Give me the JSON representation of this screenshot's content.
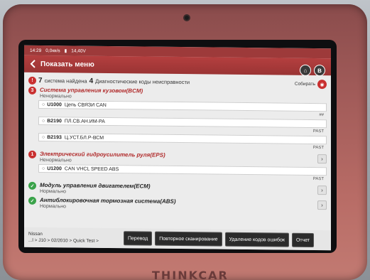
{
  "device": {
    "brand": "THINKCAR"
  },
  "status_bar": {
    "time": "14:29",
    "net_speed": "0,0кв/s",
    "voltage": "14,40V"
  },
  "header": {
    "title": "Показать меню"
  },
  "summary": {
    "systems_count": "7",
    "text_found": "система найдена",
    "dtc_count": "4",
    "text_dtc": "Диагностические коды неисправности"
  },
  "collect_label": "Собирать",
  "systems": [
    {
      "name": "Система управления кузовом(BCM)",
      "state": "Ненормально",
      "badge": "3",
      "status": "fault",
      "dtcs": [
        {
          "code": "U1000",
          "desc": "Цепь СВЯЗИ CAN",
          "status": "##"
        },
        {
          "code": "B2190",
          "desc": "ПЛ.СВ.АН.ИМ-РА",
          "status": "PAST"
        },
        {
          "code": "B2193",
          "desc": "Ц.УСТ.БЛ.Р-ВСМ",
          "status": "PAST"
        }
      ]
    },
    {
      "name": "Электрический гидроусилитель руля(EPS)",
      "state": "Ненормально",
      "badge": "1",
      "status": "fault",
      "dtcs": [
        {
          "code": "U1200",
          "desc": "CAN VHCL SPEED ABS",
          "status": "PAST"
        }
      ]
    },
    {
      "name": "Модуль управления двигателем(ECM)",
      "state": "Нормально",
      "badge": "✓",
      "status": "ok",
      "dtcs": []
    },
    {
      "name": "Антиблокировочная тормозная система(ABS)",
      "state": "Нормально",
      "badge": "✓",
      "status": "ok",
      "dtcs": []
    }
  ],
  "footer": {
    "make": "Nissan",
    "path": "...l > J10 > 02/2010 > Quick Test >",
    "buttons": [
      "Перевод",
      "Повторное сканирование",
      "Удаление кодов ошибок",
      "Отчет"
    ]
  },
  "colors": {
    "accent": "#9d3a3a",
    "fault": "#c93030",
    "ok": "#3aa34a"
  }
}
